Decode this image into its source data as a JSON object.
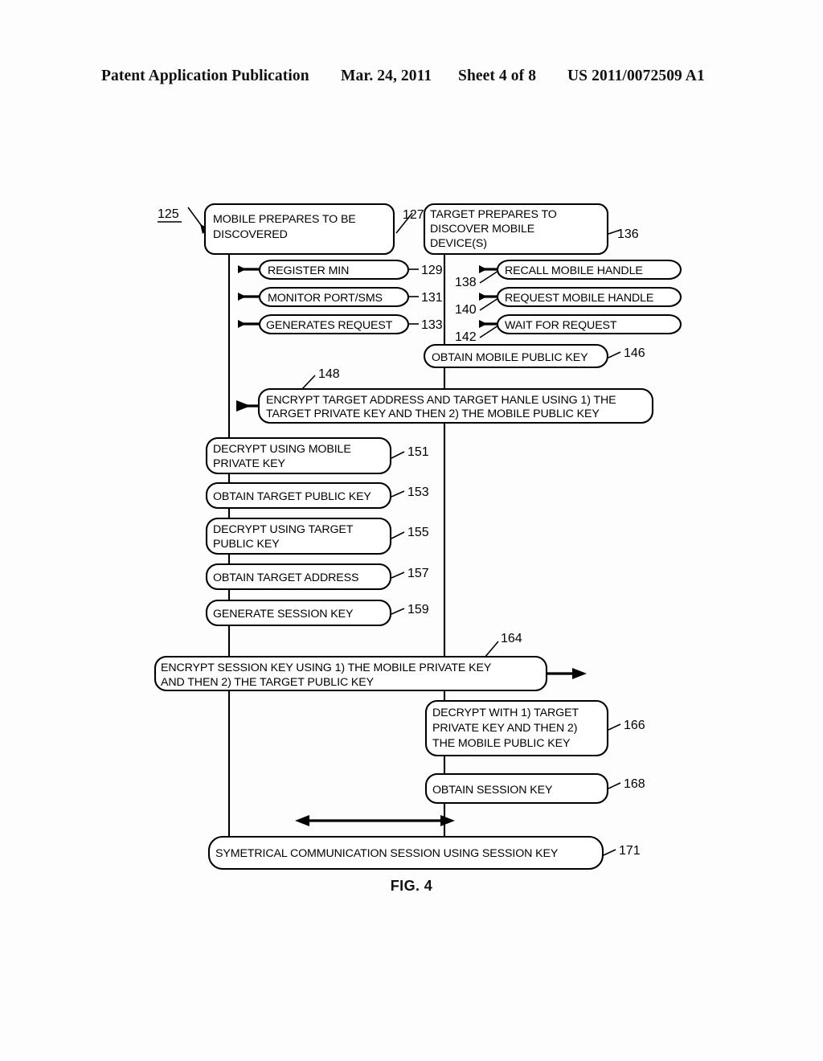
{
  "header": {
    "publication": "Patent Application Publication",
    "date": "Mar. 24, 2011",
    "sheet": "Sheet 4 of 8",
    "patent_number": "US 2011/0072509 A1"
  },
  "figure": {
    "caption": "FIG. 4",
    "diagram_ref": "125"
  },
  "lanes": {
    "mobile": {
      "title": "MOBILE PREPARES TO BE DISCOVERED",
      "ref": "127"
    },
    "target": {
      "title": "TARGET PREPARES TO DISCOVER MOBILE DEVICE(S)",
      "ref": "136"
    }
  },
  "mobile_steps": [
    {
      "label": "REGISTER MIN",
      "ref": "129"
    },
    {
      "label": "MONITOR PORT/SMS",
      "ref": "131"
    },
    {
      "label": "GENERATES REQUEST",
      "ref": "133"
    }
  ],
  "target_steps": [
    {
      "label": "RECALL MOBILE HANDLE",
      "ref": "138"
    },
    {
      "label": "REQUEST MOBILE HANDLE",
      "ref": "140"
    },
    {
      "label": "WAIT FOR REQUEST",
      "ref": "142"
    }
  ],
  "target_obtain": {
    "label": "OBTAIN MOBILE PUBLIC KEY",
    "ref": "146"
  },
  "encrypt_target": {
    "line1": "ENCRYPT TARGET ADDRESS AND TARGET HANLE USING 1) THE",
    "line2": "TARGET PRIVATE KEY AND THEN 2) THE MOBILE PUBLIC KEY",
    "ref": "148"
  },
  "mobile_chain": [
    {
      "line1": "DECRYPT USING MOBILE",
      "line2": "PRIVATE KEY",
      "ref": "151"
    },
    {
      "line1": "OBTAIN TARGET PUBLIC KEY",
      "line2": "",
      "ref": "153"
    },
    {
      "line1": "DECRYPT USING TARGET",
      "line2": "PUBLIC KEY",
      "ref": "155"
    },
    {
      "line1": "OBTAIN TARGET ADDRESS",
      "line2": "",
      "ref": "157"
    },
    {
      "line1": "GENERATE SESSION KEY",
      "line2": "",
      "ref": "159"
    }
  ],
  "encrypt_session": {
    "line1": "ENCRYPT SESSION KEY USING 1) THE MOBILE PRIVATE KEY",
    "line2": "AND THEN 2) THE TARGET PUBLIC KEY",
    "ref": "164"
  },
  "target_decrypt": {
    "line1": "DECRYPT WITH 1) TARGET",
    "line2": "PRIVATE KEY AND THEN 2)",
    "line3": "THE MOBILE PUBLIC KEY",
    "ref": "166"
  },
  "target_session": {
    "label": "OBTAIN SESSION KEY",
    "ref": "168"
  },
  "final": {
    "label": "SYMETRICAL COMMUNICATION SESSION USING SESSION KEY",
    "ref": "171"
  },
  "colors": {
    "ink": "#000000",
    "paper": "#ffffff"
  }
}
